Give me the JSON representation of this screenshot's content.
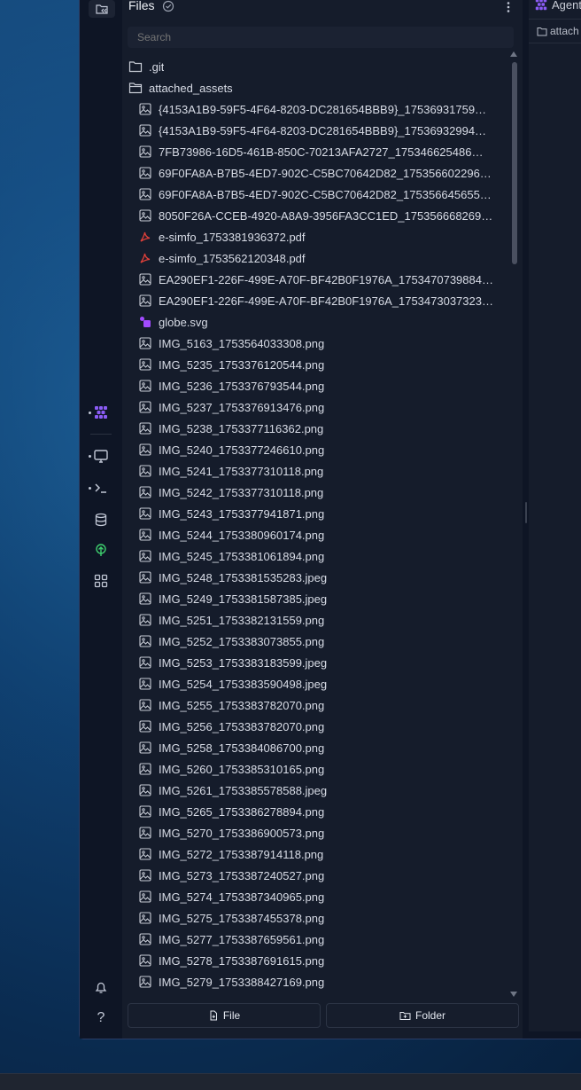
{
  "panel": {
    "title": "Files",
    "search_placeholder": "Search"
  },
  "right_panel": {
    "tab_label": "Agent",
    "breadcrumb": "attach"
  },
  "tree": [
    {
      "label": ".git",
      "type": "folder",
      "depth": 0
    },
    {
      "label": "attached_assets",
      "type": "folder-open",
      "depth": 0
    },
    {
      "label": "{4153A1B9-59F5-4F64-8203-DC281654BBB9}_17536931759…",
      "type": "image",
      "depth": 1
    },
    {
      "label": "{4153A1B9-59F5-4F64-8203-DC281654BBB9}_17536932994…",
      "type": "image",
      "depth": 1
    },
    {
      "label": "7FB73986-16D5-461B-850C-70213AFA2727_175346625486…",
      "type": "image",
      "depth": 1
    },
    {
      "label": "69F0FA8A-B7B5-4ED7-902C-C5BC70642D82_175356602296…",
      "type": "image",
      "depth": 1
    },
    {
      "label": "69F0FA8A-B7B5-4ED7-902C-C5BC70642D82_175356645655…",
      "type": "image",
      "depth": 1
    },
    {
      "label": "8050F26A-CCEB-4920-A8A9-3956FA3CC1ED_175356668269…",
      "type": "image",
      "depth": 1
    },
    {
      "label": "e-simfo_1753381936372.pdf",
      "type": "pdf",
      "depth": 1
    },
    {
      "label": "e-simfo_1753562120348.pdf",
      "type": "pdf",
      "depth": 1
    },
    {
      "label": "EA290EF1-226F-499E-A70F-BF42B0F1976A_1753470739884…",
      "type": "image",
      "depth": 1
    },
    {
      "label": "EA290EF1-226F-499E-A70F-BF42B0F1976A_1753473037323…",
      "type": "image",
      "depth": 1
    },
    {
      "label": "globe.svg",
      "type": "svg",
      "depth": 1
    },
    {
      "label": "IMG_5163_1753564033308.png",
      "type": "image",
      "depth": 1
    },
    {
      "label": "IMG_5235_1753376120544.png",
      "type": "image",
      "depth": 1
    },
    {
      "label": "IMG_5236_1753376793544.png",
      "type": "image",
      "depth": 1
    },
    {
      "label": "IMG_5237_1753376913476.png",
      "type": "image",
      "depth": 1
    },
    {
      "label": "IMG_5238_1753377116362.png",
      "type": "image",
      "depth": 1
    },
    {
      "label": "IMG_5240_1753377246610.png",
      "type": "image",
      "depth": 1
    },
    {
      "label": "IMG_5241_1753377310118.png",
      "type": "image",
      "depth": 1
    },
    {
      "label": "IMG_5242_1753377310118.png",
      "type": "image",
      "depth": 1
    },
    {
      "label": "IMG_5243_1753377941871.png",
      "type": "image",
      "depth": 1
    },
    {
      "label": "IMG_5244_1753380960174.png",
      "type": "image",
      "depth": 1
    },
    {
      "label": "IMG_5245_1753381061894.png",
      "type": "image",
      "depth": 1
    },
    {
      "label": "IMG_5248_1753381535283.jpeg",
      "type": "image",
      "depth": 1
    },
    {
      "label": "IMG_5249_1753381587385.jpeg",
      "type": "image",
      "depth": 1
    },
    {
      "label": "IMG_5251_1753382131559.png",
      "type": "image",
      "depth": 1
    },
    {
      "label": "IMG_5252_1753383073855.png",
      "type": "image",
      "depth": 1
    },
    {
      "label": "IMG_5253_1753383183599.jpeg",
      "type": "image",
      "depth": 1
    },
    {
      "label": "IMG_5254_1753383590498.jpeg",
      "type": "image",
      "depth": 1
    },
    {
      "label": "IMG_5255_1753383782070.png",
      "type": "image",
      "depth": 1
    },
    {
      "label": "IMG_5256_1753383782070.png",
      "type": "image",
      "depth": 1
    },
    {
      "label": "IMG_5258_1753384086700.png",
      "type": "image",
      "depth": 1
    },
    {
      "label": "IMG_5260_1753385310165.png",
      "type": "image",
      "depth": 1
    },
    {
      "label": "IMG_5261_1753385578588.jpeg",
      "type": "image",
      "depth": 1
    },
    {
      "label": "IMG_5265_1753386278894.png",
      "type": "image",
      "depth": 1
    },
    {
      "label": "IMG_5270_1753386900573.png",
      "type": "image",
      "depth": 1
    },
    {
      "label": "IMG_5272_1753387914118.png",
      "type": "image",
      "depth": 1
    },
    {
      "label": "IMG_5273_1753387240527.png",
      "type": "image",
      "depth": 1
    },
    {
      "label": "IMG_5274_1753387340965.png",
      "type": "image",
      "depth": 1
    },
    {
      "label": "IMG_5275_1753387455378.png",
      "type": "image",
      "depth": 1
    },
    {
      "label": "IMG_5277_1753387659561.png",
      "type": "image",
      "depth": 1
    },
    {
      "label": "IMG_5278_1753387691615.png",
      "type": "image",
      "depth": 1
    },
    {
      "label": "IMG_5279_1753388427169.png",
      "type": "image",
      "depth": 1
    }
  ],
  "footer": {
    "new_file_label": "File",
    "new_folder_label": "Folder"
  },
  "colors": {
    "panel_bg": "#151c2b",
    "rail_bg": "#0e1525",
    "text": "#d8dce6",
    "pdf_icon": "#e0403a",
    "svg_icon": "#a24bff",
    "accent_purple": "#8b5cf6",
    "deploy_green": "#3ecf6e"
  }
}
